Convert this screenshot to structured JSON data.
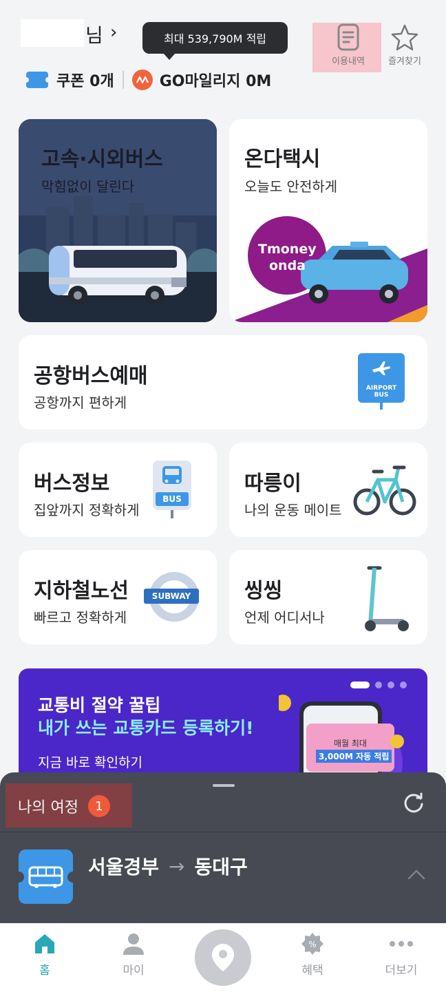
{
  "header": {
    "user_suffix": "님",
    "chevron": "›",
    "tooltip": "최대 539,790M 적립",
    "history_label": "이용내역",
    "favorites_label": "즐겨찾기",
    "coupon": "쿠폰 0개",
    "mileage": "GO마일리지 0M"
  },
  "services": {
    "bus": {
      "title": "고속·시외버스",
      "sub": "막힘없이 달린다"
    },
    "taxi": {
      "title": "온다택시",
      "sub": "오늘도 안전하게",
      "logo_line1": "Tmoney",
      "logo_line2": "onda"
    },
    "airport": {
      "title": "공항버스예매",
      "sub": "공항까지 편하게",
      "sign_line1": "AIRPORT",
      "sign_line2": "BUS"
    },
    "bus_info": {
      "title": "버스정보",
      "sub": "집앞까지 정확하게",
      "sign": "BUS"
    },
    "bike": {
      "title": "따릉이",
      "sub": "나의 운동 메이트"
    },
    "subway": {
      "title": "지하철노선",
      "sub": "빠르고 정확하게",
      "sign": "SUBWAY"
    },
    "scooter": {
      "title": "씽씽",
      "sub": "언제 어디서나"
    }
  },
  "banner": {
    "line1": "교통비 절약 꿀팁",
    "line2": "내가 쓰는 교통카드 등록하기!",
    "line3": "지금 바로 확인하기",
    "card_line1": "매월 최대",
    "card_line2": "3,000M 자동 적립",
    "slide_count": 4,
    "active_slide": 1
  },
  "journey": {
    "title": "나의 여정",
    "count": "1",
    "from": "서울경부",
    "arrow": "→",
    "to": "동대구"
  },
  "nav": {
    "home": "홈",
    "my": "마이",
    "benefits": "혜택",
    "more": "더보기"
  },
  "colors": {
    "accent_teal": "#29a6b8",
    "brand_blue": "#3d97e6",
    "orange": "#ef5b3a",
    "banner_purple": "#4b27c9",
    "sheet_dark": "#474a52"
  }
}
